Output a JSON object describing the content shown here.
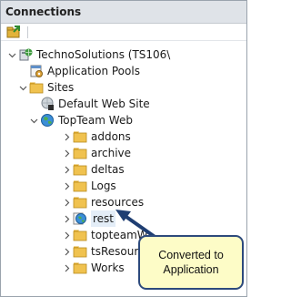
{
  "panel": {
    "title": "Connections"
  },
  "toolbar": {
    "icons": [
      "connect-icon"
    ]
  },
  "tree": {
    "server": "TechnoSolutions (TS106\\",
    "app_pools": "Application Pools",
    "sites": "Sites",
    "default_site": "Default Web Site",
    "topteam_web": "TopTeam Web",
    "children": [
      "addons",
      "archive",
      "deltas",
      "Logs",
      "resources",
      "rest",
      "topteamW",
      "tsResourc",
      "Works"
    ]
  },
  "callout": {
    "text": "Converted to Application"
  },
  "colors": {
    "folder": "#e9b93c",
    "callout_fill": "#fdfcc7",
    "callout_border": "#2d4a7c",
    "arrow": "#1f3e72"
  }
}
